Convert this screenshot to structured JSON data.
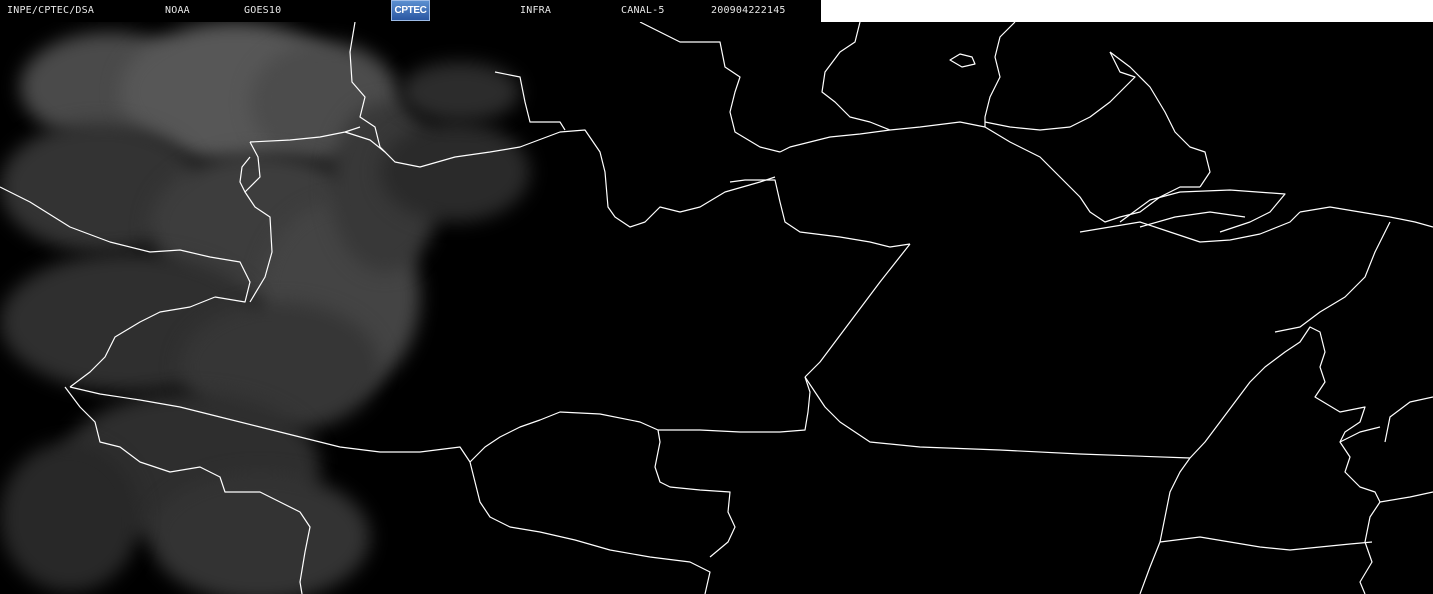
{
  "header": {
    "source": "INPE/CPTEC/DSA",
    "agency": "NOAA",
    "satellite": "GOES10",
    "logo_text": "CPTEC",
    "band": "INFRA",
    "channel": "CANAL-5",
    "timestamp": "200904222145"
  },
  "colors": {
    "background": "#000000",
    "border_lines": "#ffffff",
    "cloud_tones": "#5a5a5a",
    "header_text": "#e8e8e8",
    "logo_blue": "#2a57a2"
  }
}
